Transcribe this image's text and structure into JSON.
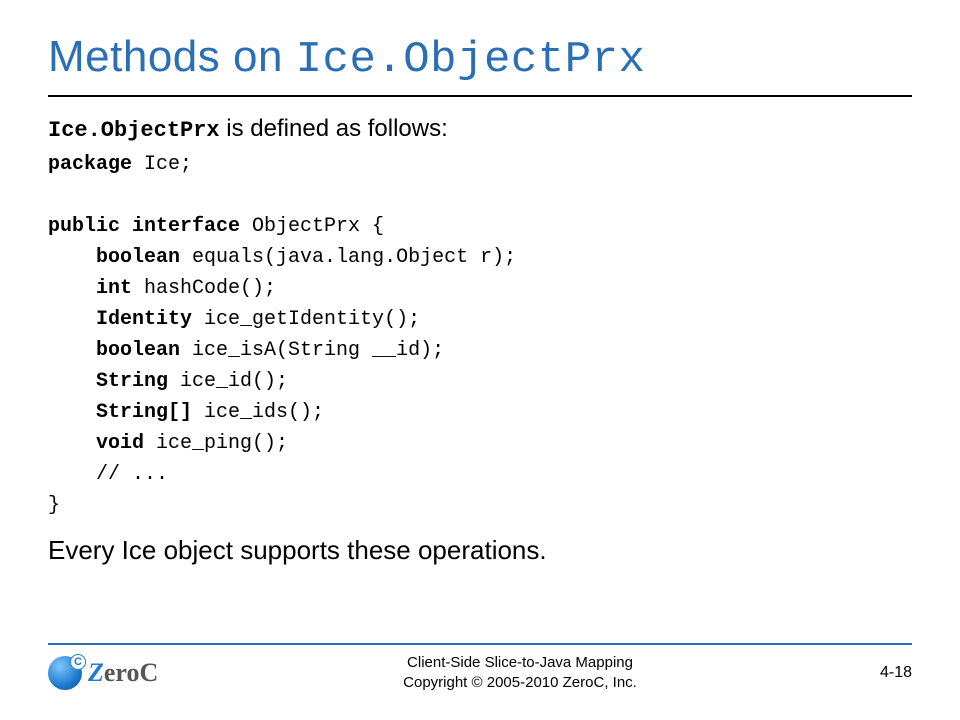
{
  "title": {
    "plain": "Methods on ",
    "mono": "Ice.ObjectPrx"
  },
  "intro": {
    "mono": "Ice.ObjectPrx",
    "rest": " is defined as follows:"
  },
  "code": {
    "l1a": "package",
    "l1b": " Ice;",
    "l2a": "public interface",
    "l2b": " ObjectPrx {",
    "l3a": "    boolean",
    "l3b": " equals(java.lang.Object r);",
    "l4a": "    int",
    "l4b": " hashCode();",
    "l5a": "    Identity",
    "l5b": " ice_getIdentity();",
    "l6a": "    boolean",
    "l6b": " ice_isA(String __id);",
    "l7a": "    String",
    "l7b": " ice_id();",
    "l8a": "    String[]",
    "l8b": " ice_ids();",
    "l9a": "    void",
    "l9b": " ice_ping();",
    "l10": "    // ...",
    "l11": "}"
  },
  "outro": "Every Ice object supports these operations.",
  "footer": {
    "line1": "Client-Side Slice-to-Java Mapping",
    "line2": "Copyright © 2005-2010 ZeroC, Inc.",
    "page": "4-18",
    "logo_z": "Z",
    "logo_rest": "eroC"
  }
}
